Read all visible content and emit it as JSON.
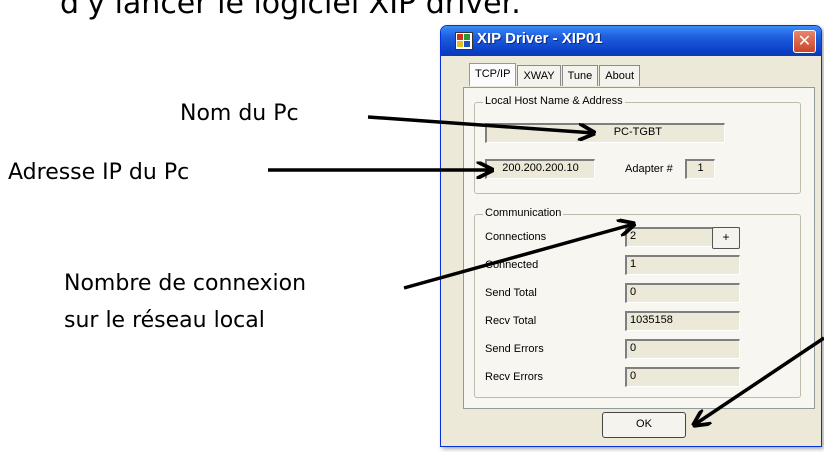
{
  "heading_fragment": "d'y lancer le logiciel XIP driver.",
  "annotations": {
    "host_name": "Nom du Pc",
    "ip_address": "Adresse IP du Pc",
    "connections_line1": "Nombre de connexion",
    "connections_line2": "sur le réseau local"
  },
  "window": {
    "title": "XIP Driver - XIP01",
    "close_glyph": "✕",
    "tabs": [
      "TCP/IP",
      "XWAY",
      "Tune",
      "About"
    ],
    "active_tab": "TCP/IP"
  },
  "local_host": {
    "group_label": "Local Host Name & Address",
    "name": "PC-TGBT",
    "ip": "200.200.200.10",
    "adapter_label": "Adapter #",
    "adapter_value": "1"
  },
  "communication": {
    "group_label": "Communication",
    "rows": [
      {
        "label": "Connections",
        "value": "2"
      },
      {
        "label": "Connected",
        "value": "1"
      },
      {
        "label": "Send Total",
        "value": "0"
      },
      {
        "label": "Recv Total",
        "value": "1035158"
      },
      {
        "label": "Send Errors",
        "value": "0"
      },
      {
        "label": "Recv Errors",
        "value": "0"
      }
    ],
    "plus_label": "+"
  },
  "ok_label": "OK"
}
